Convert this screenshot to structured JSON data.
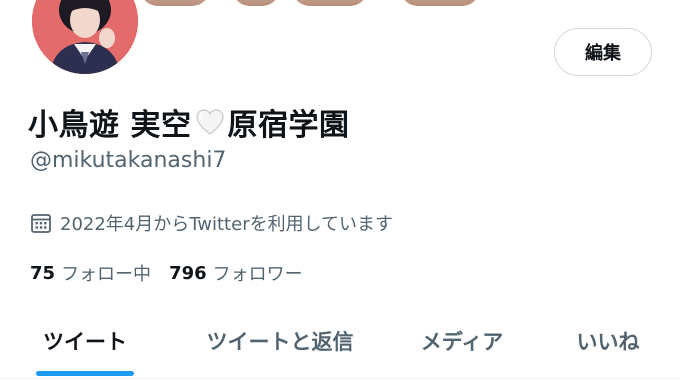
{
  "profile": {
    "name_part1": "小鳥遊 実空",
    "name_part2": "原宿学園",
    "handle": "@mikutakanashi7",
    "joined": "2022年4月からTwitterを利用しています"
  },
  "actions": {
    "edit_label": "編集"
  },
  "stats": {
    "following_count": "75",
    "following_label": "フォロー中",
    "followers_count": "796",
    "followers_label": "フォロワー"
  },
  "tabs": [
    {
      "label": "ツイート",
      "active": true
    },
    {
      "label": "ツイートと返信",
      "active": false
    },
    {
      "label": "メディア",
      "active": false
    },
    {
      "label": "いいね",
      "active": false
    }
  ],
  "colors": {
    "accent": "#1d9bf0",
    "text_primary": "#0f1419",
    "text_secondary": "#536471",
    "border": "#cfd9de"
  },
  "icons": {
    "calendar": "calendar-icon",
    "heart": "white-heart-icon"
  }
}
